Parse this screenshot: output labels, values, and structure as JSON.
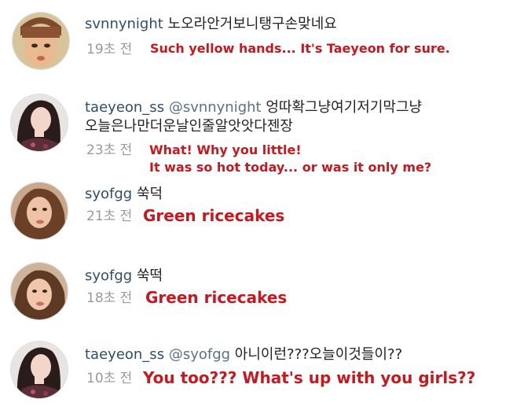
{
  "comments": [
    {
      "username": "svnnynight",
      "mention": "",
      "text": "노오라안거보니탱구손맞네요",
      "text_line2": "",
      "time": "19초 전",
      "translation": "Such yellow hands... It's Taeyeon for sure.",
      "translation_line2": ""
    },
    {
      "username": "taeyeon_ss",
      "mention": "@svnnynight",
      "text": "엉따확그냥여기저기막그냥",
      "text_line2": "오늘은나만더운날인줄알앗앗다젠장",
      "time": "23초 전",
      "translation": "What! Why you little!",
      "translation_line2": "It was so hot today... or was it only me?"
    },
    {
      "username": "syofgg",
      "mention": "",
      "text": "쑥덕",
      "text_line2": "",
      "time": "21초 전",
      "translation": "Green ricecakes",
      "translation_line2": ""
    },
    {
      "username": "syofgg",
      "mention": "",
      "text": "쑥떡",
      "text_line2": "",
      "time": "18초 전",
      "translation": "Green ricecakes",
      "translation_line2": ""
    },
    {
      "username": "taeyeon_ss",
      "mention": "@syofgg",
      "text": "아니이런???오늘이것들이??",
      "text_line2": "",
      "time": "10초 전",
      "translation": "You too??? What's up with you girls??",
      "translation_line2": ""
    }
  ],
  "colors": {
    "username": "#2f4e6b",
    "timestamp": "#9a9a9a",
    "translation": "#c8181f"
  }
}
